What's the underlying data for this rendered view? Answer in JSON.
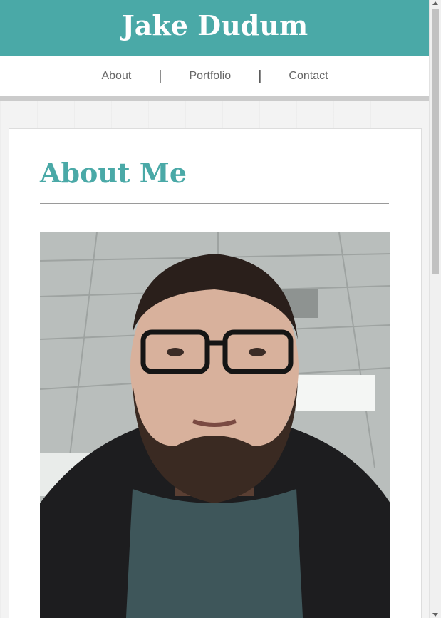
{
  "header": {
    "title": "Jake Dudum"
  },
  "nav": {
    "items": [
      {
        "label": "About"
      },
      {
        "label": "Portfolio"
      },
      {
        "label": "Contact"
      }
    ],
    "separator": "|"
  },
  "main": {
    "heading": "About Me"
  },
  "colors": {
    "accent": "#4aa9a7",
    "nav_text": "#666666"
  }
}
